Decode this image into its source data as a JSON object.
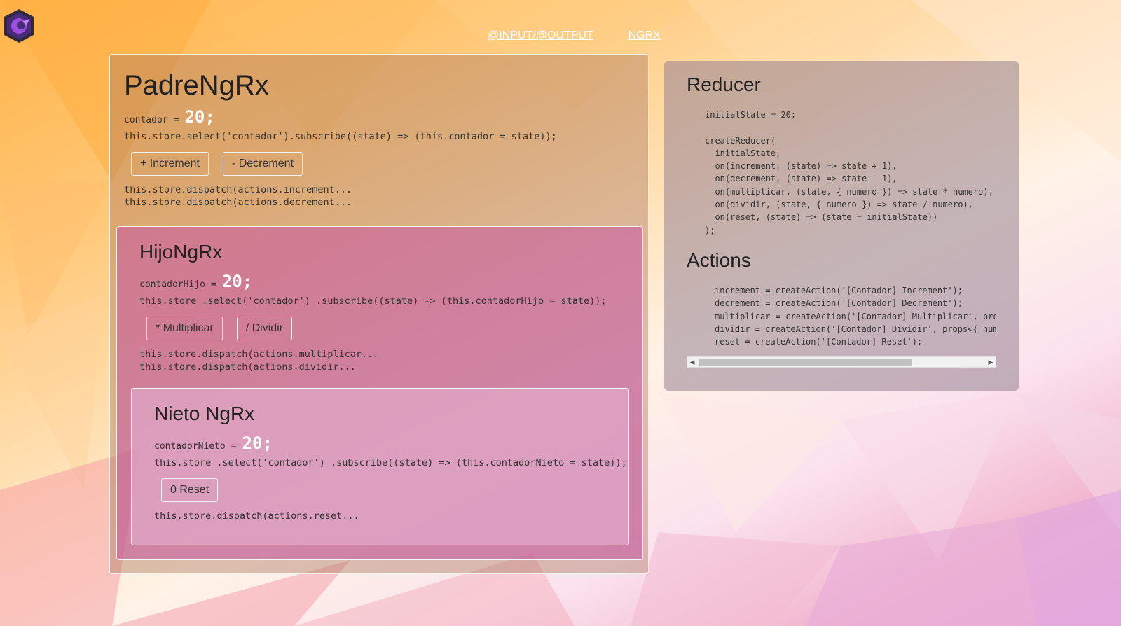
{
  "nav": {
    "link_io": "@INPUT/@OUTPUT",
    "link_ngrx": "NGRX"
  },
  "padre": {
    "title": "PadreNgRx",
    "counter_name": "contador",
    "counter_eq": "=",
    "counter_value": "20;",
    "select_code": "this.store.select('contador').subscribe((state) => (this.contador = state));",
    "btn_increment": "+ Increment",
    "btn_decrement": "- Decrement",
    "dispatch_increment": "this.store.dispatch(actions.increment...",
    "dispatch_decrement": "this.store.dispatch(actions.decrement..."
  },
  "hijo": {
    "title": "HijoNgRx",
    "counter_name": "contadorHijo",
    "counter_eq": "=",
    "counter_value": "20;",
    "select_code": "this.store .select('contador') .subscribe((state) => (this.contadorHijo = state));",
    "btn_multiplicar": "* Multiplicar",
    "btn_dividir": "/ Dividir",
    "dispatch_multiplicar": "this.store.dispatch(actions.multiplicar...",
    "dispatch_dividir": "this.store.dispatch(actions.dividir..."
  },
  "nieto": {
    "title": "Nieto NgRx",
    "counter_name": "contadorNieto",
    "counter_eq": "=",
    "counter_value": "20;",
    "select_code": "this.store .select('contador') .subscribe((state) => (this.contadorNieto = state));",
    "btn_reset": "0 Reset",
    "dispatch_reset": "this.store.dispatch(actions.reset..."
  },
  "reducer": {
    "title": "Reducer",
    "code": "initialState = 20;\n\ncreateReducer(\n  initialState,\n  on(increment, (state) => state + 1),\n  on(decrement, (state) => state - 1),\n  on(multiplicar, (state, { numero }) => state * numero),\n  on(dividir, (state, { numero }) => state / numero),\n  on(reset, (state) => (state = initialState))\n);",
    "actions_title": "Actions",
    "actions_code": "increment = createAction('[Contador] Increment');\ndecrement = createAction('[Contador] Decrement');\nmultiplicar = createAction('[Contador] Multiplicar', props<{\ndividir = createAction('[Contador] Dividir', props<{ numero:\nreset = createAction('[Contador] Reset');"
  },
  "colors": {
    "bg_top_left": "#ffb347",
    "bg_bottom_right": "#e9a9d8",
    "padre_panel": "#aa785f",
    "hijo_panel": "#c85aa0",
    "nieto_panel": "#e6b4d2",
    "reducer_panel": "#968291",
    "logo_accent": "#7b3fd1"
  },
  "icons": {
    "logo": "ngrx-logo-icon",
    "scroll_left": "triangle-left-icon",
    "scroll_right": "triangle-right-icon"
  }
}
